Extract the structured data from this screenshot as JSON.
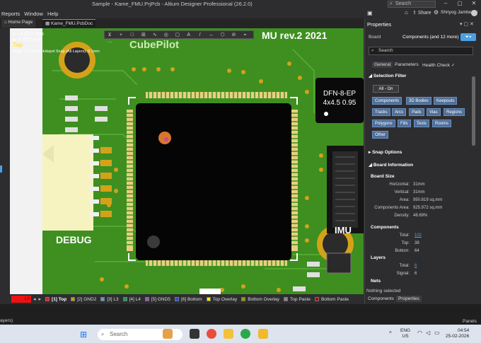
{
  "window": {
    "title": "Sample - Kame_FMU.PrjPcb - Altium Designer Professional (26.2.0)",
    "search_placeholder": "Search",
    "user": "Shriyog Jambekar",
    "share_label": "Share"
  },
  "menu": [
    "Reports",
    "Window",
    "Help"
  ],
  "doc_tabs": [
    "Home Page",
    "Kame_FMU.PcbDoc"
  ],
  "cursor_readout": {
    "x": "x: -4.037 mm",
    "y": "y:  3.657 mm",
    "layer": "Top",
    "snap": "Snap: 0.025mm Hotspot Snap (All Layers): 0.1mm"
  },
  "pcb_labels": {
    "board_title": "MU rev.2 2021",
    "logo": "CubePilot",
    "dfn_line1": "DFN-8-EP",
    "dfn_line2": "4x4.5 0.95",
    "debug": "DEBUG",
    "imu": "IMU"
  },
  "layer_bar": {
    "current": "LS",
    "layers": [
      {
        "label": "[1] Top",
        "color": "#e02020"
      },
      {
        "label": "[2] GND2",
        "color": "#c8a000"
      },
      {
        "label": "[3] L3",
        "color": "#4fa0e0"
      },
      {
        "label": "[4] L4",
        "color": "#20a050"
      },
      {
        "label": "[5] GND5",
        "color": "#a050c0"
      },
      {
        "label": "[6] Bottom",
        "color": "#2050e0"
      },
      {
        "label": "Top Overlay",
        "color": "#ffee00"
      },
      {
        "label": "Bottom Overlay",
        "color": "#999900"
      },
      {
        "label": "Top Paste",
        "color": "#888888"
      },
      {
        "label": "Bottom Paste",
        "color": "#aa0000"
      }
    ]
  },
  "status": {
    "left": "ayers)",
    "panels": "Panels"
  },
  "properties": {
    "header": "Properties",
    "board_label": "Board",
    "selection": "Components (and 12 more)",
    "search_placeholder": "Search",
    "tabs": [
      "General",
      "Parameters",
      "Health Check ✓"
    ],
    "selection_filter_title": "Selection Filter",
    "all_on": "All - On",
    "filter_buttons": [
      "Components",
      "3D Bodies",
      "Keepouts",
      "Tracks",
      "Arcs",
      "Pads",
      "Vias",
      "Regions",
      "Polygons",
      "Fills",
      "Texts",
      "Rooms",
      "Other"
    ],
    "snap_options": "Snap Options",
    "board_information": "Board Information",
    "board_size_title": "Board Size",
    "board_size": [
      {
        "k": "Horizontal:",
        "v": "31mm"
      },
      {
        "k": "Vertical:",
        "v": "31mm"
      },
      {
        "k": "Area:",
        "v": "950.819 sq.mm"
      },
      {
        "k": "Components Area:",
        "v": "925.972 sq.mm"
      },
      {
        "k": "Density:",
        "v": "48.69%"
      }
    ],
    "components_title": "Components",
    "components": [
      {
        "k": "Total:",
        "v": "102"
      },
      {
        "k": "Top:",
        "v": "38"
      },
      {
        "k": "Bottom:",
        "v": "64"
      }
    ],
    "layers_title": "Layers",
    "layers": [
      {
        "k": "Total:",
        "v": "6"
      },
      {
        "k": "Signal:",
        "v": "6"
      }
    ],
    "nets_title": "Nets",
    "nothing_selected": "Nothing selected",
    "bottom_tabs": [
      "Components",
      "Properties"
    ]
  },
  "taskbar": {
    "search_placeholder": "Search",
    "lang": "ENG",
    "region": "US",
    "time": "04:54",
    "date": "25-02-2026"
  }
}
